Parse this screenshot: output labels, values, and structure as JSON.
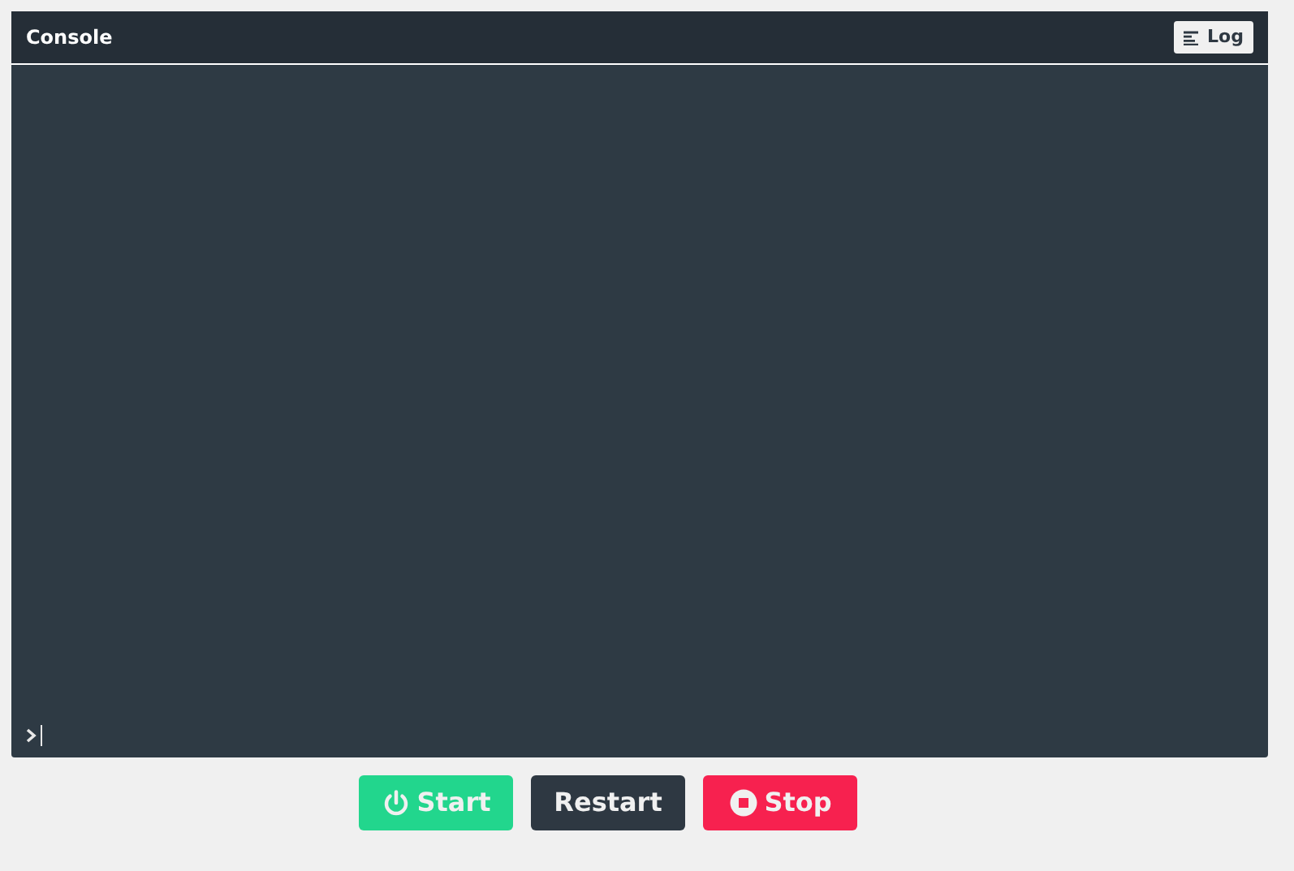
{
  "console": {
    "title": "Console",
    "log_button": "Log"
  },
  "buttons": [
    {
      "label": "Start",
      "kind": "start"
    },
    {
      "label": "Restart",
      "kind": "restart"
    },
    {
      "label": "Stop",
      "kind": "stop"
    }
  ]
}
